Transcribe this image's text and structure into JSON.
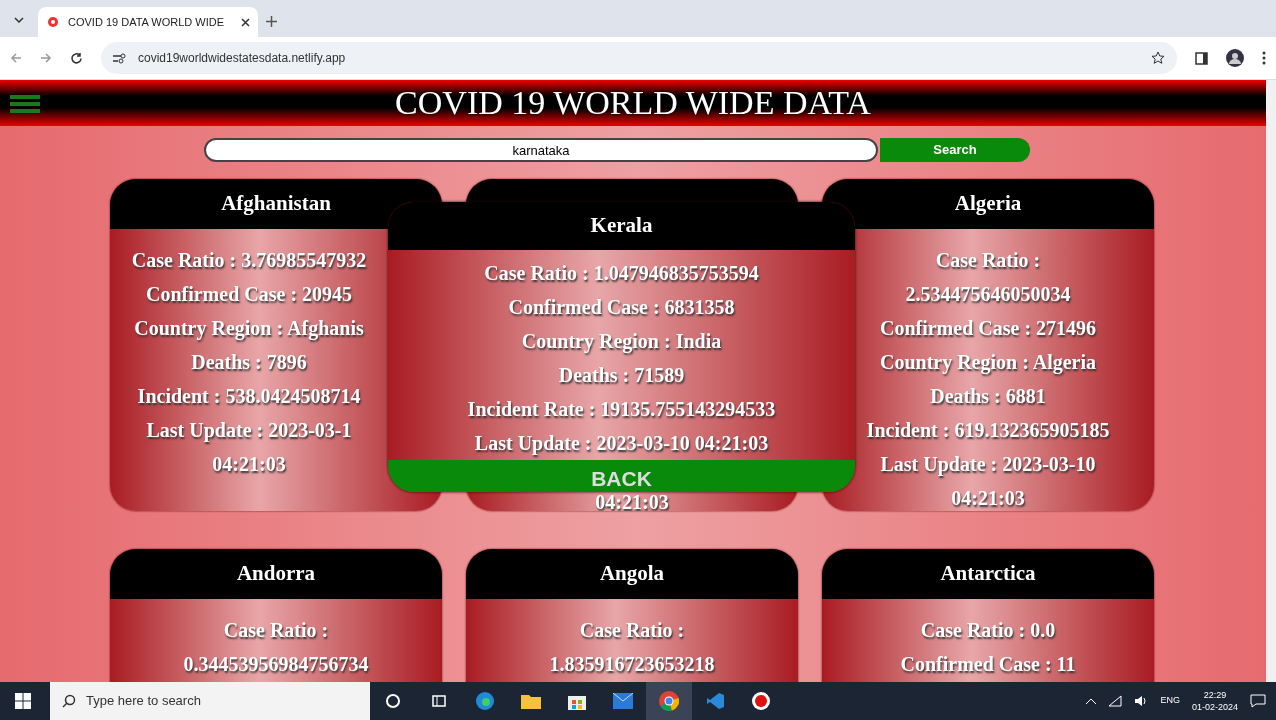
{
  "browser": {
    "tabs": [
      {
        "title": "COVID 19 DATA WORLD WIDE",
        "selected": true
      }
    ],
    "url": "covid19worldwidestatesdata.netlify.app"
  },
  "page": {
    "title": "COVID 19 WORLD WIDE DATA",
    "search": {
      "value": "karnataka",
      "button": "Search"
    },
    "cards": [
      {
        "title": "Afghanistan",
        "lines": [
          "Case Ratio : 3.76985547932",
          "Confirmed Case : 20945",
          "Country Region : Afghanis",
          "Deaths : 7896",
          "Incident : 538.0424508714",
          "Last Update : 2023-03-1",
          "04:21:03"
        ]
      },
      {
        "lines": [
          "04:21:03"
        ]
      },
      {
        "title": "Algeria",
        "lines": [
          "Case Ratio :",
          "2.534475646050034",
          "Confirmed Case : 271496",
          "Country Region : Algeria",
          "Deaths : 6881",
          "Incident : 619.132365905185",
          "Last Update : 2023-03-10",
          "04:21:03"
        ]
      },
      {
        "title": "Andorra",
        "lines": [
          "Case Ratio :",
          "0.34453956984756734"
        ]
      },
      {
        "title": "Angola",
        "lines": [
          "Case Ratio :",
          "1.835916723653218"
        ]
      },
      {
        "title": "Antarctica",
        "lines": [
          "Case Ratio : 0.0",
          "Confirmed Case : 11"
        ]
      }
    ],
    "modal": {
      "title": "Kerala",
      "lines": [
        "Case Ratio : 1.047946835753594",
        "Confirmed Case : 6831358",
        "Country Region : India",
        "Deaths : 71589",
        "Incident Rate : 19135.755143294533",
        "Last Update : 2023-03-10 04:21:03"
      ],
      "button": "BACK"
    }
  },
  "taskbar": {
    "search_placeholder": "Type here to search",
    "language": "ENG",
    "time": "22:29",
    "date": "01-02-2024"
  }
}
